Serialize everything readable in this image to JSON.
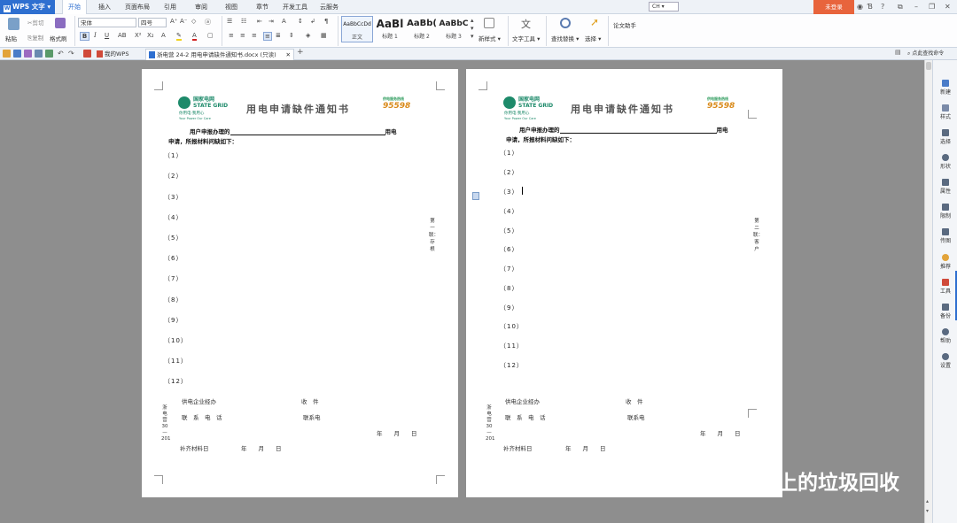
{
  "app": {
    "name": "WPS 文字"
  },
  "menu": {
    "items": [
      "开始",
      "插入",
      "页面布局",
      "引用",
      "审阅",
      "视图",
      "章节",
      "开发工具",
      "云服务"
    ],
    "active": "开始"
  },
  "titlebar": {
    "lang": "CH",
    "login": "未登录"
  },
  "ribbon": {
    "paste": "粘贴",
    "cut": "剪切",
    "copy": "复制",
    "format_painter": "格式刷",
    "font_name": "宋体",
    "font_size": "四号",
    "styles": [
      {
        "preview": "AaBbCcDd",
        "label": "正文"
      },
      {
        "preview": "AaBl",
        "label": "标题 1"
      },
      {
        "preview": "AaBb(",
        "label": "标题 2"
      },
      {
        "preview": "AaBbC",
        "label": "标题 3"
      }
    ],
    "new_style": "新样式",
    "text_tools": "文字工具",
    "find_replace": "查找替换",
    "select": "选择",
    "thesis": "论文助手"
  },
  "tabs": {
    "home": "我的WPS",
    "active_doc": "浙电营 24-2 用电申请缺件通知书.docx (只读)",
    "cmd_search": "点此查找命令"
  },
  "document": {
    "sg_cn": "国家电网",
    "sg_en": "STATE GRID",
    "sg_slogan": "你用电·我用心",
    "sg_sub": "Your Power Our Care",
    "hotline": "95598",
    "hotline_small": "供电服务热线",
    "title": "用电申请缺件通知书",
    "line1_prefix": "用户申报办理的",
    "line1_suffix": "用电",
    "line2": "申请，所报材料问缺如下：",
    "items": [
      "（1）",
      "（2）",
      "（3）",
      "（4）",
      "（5）",
      "（6）",
      "（7）",
      "（8）",
      "（9）",
      "（10）",
      "（11）",
      "（12）"
    ],
    "footer_agent": "供电企业经办",
    "footer_receive": "收　件",
    "footer_phone_label": "联　系　电　话",
    "footer_contact": "联系电",
    "footer_date": "年　　月　　日",
    "footer_supplement": "补齐材料日",
    "footer_supp_date": "年　　月　　日",
    "side_left": "浙电营 30—201",
    "page1_side": "第一联：存根",
    "page2_side": "第二联：客户"
  },
  "sidepanel": {
    "items": [
      "新建",
      "样式",
      "选择",
      "形状",
      "属性",
      "限制",
      "传图",
      "推荐",
      "工具",
      "备份",
      "帮助",
      "设置"
    ]
  },
  "watermark": "路上的垃圾回收"
}
